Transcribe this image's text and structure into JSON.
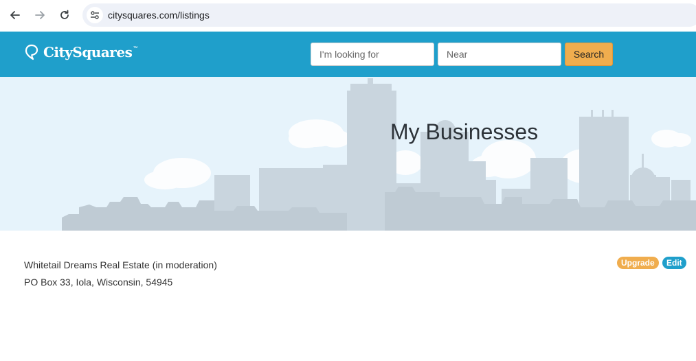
{
  "browser": {
    "url": "citysquares.com/listings"
  },
  "header": {
    "logo_text": "CitySquares",
    "logo_tm": "™",
    "search_placeholder": "I'm looking for",
    "near_placeholder": "Near",
    "search_label": "Search"
  },
  "hero": {
    "title": "My Businesses"
  },
  "listing": {
    "name": "Whitetail Dreams Real Estate (in moderation)",
    "address": "PO Box 33, Iola, Wisconsin, 54945",
    "upgrade_label": "Upgrade",
    "edit_label": "Edit"
  },
  "colors": {
    "header_bg": "#1f9fcb",
    "search_button": "#f0ad4e",
    "upgrade_badge": "#f0ad4e",
    "edit_badge": "#1f9fcb"
  }
}
